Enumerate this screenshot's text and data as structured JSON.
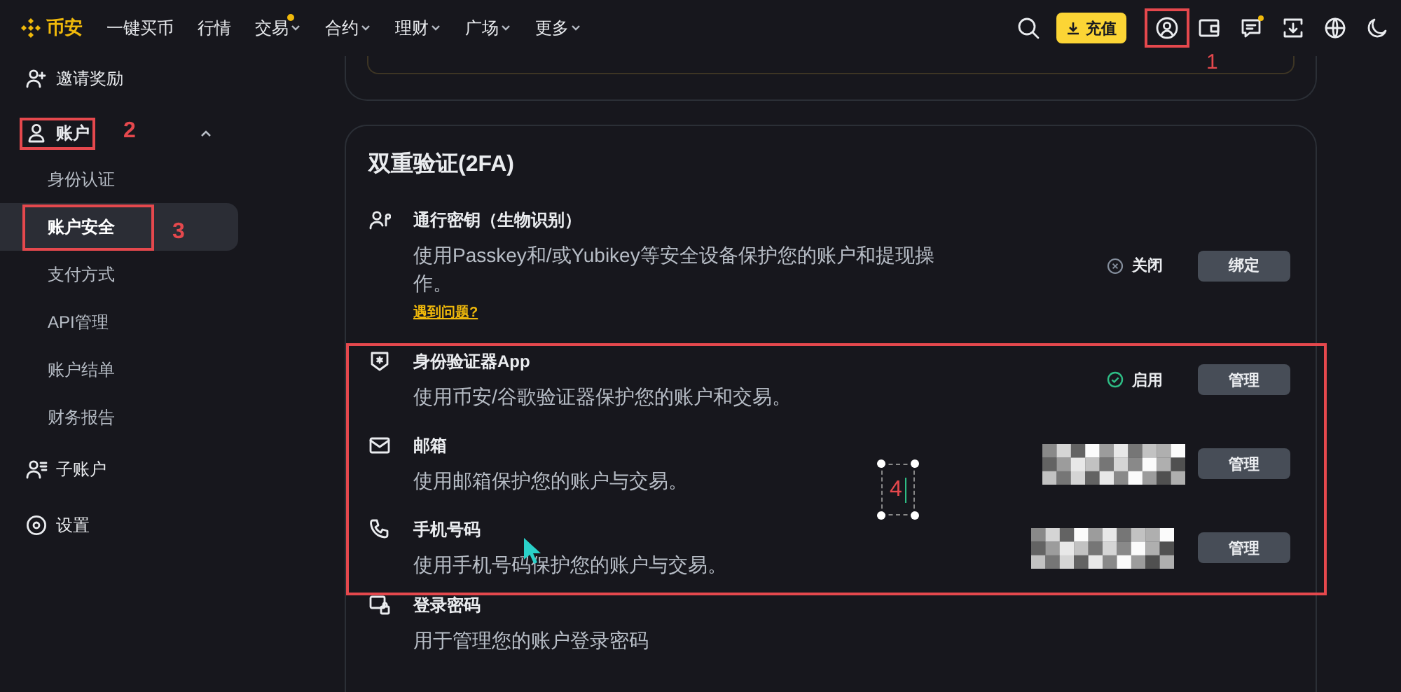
{
  "header": {
    "logo": "币安",
    "nav": [
      {
        "label": "一键买币",
        "dropdown": false,
        "dot": false
      },
      {
        "label": "行情",
        "dropdown": false,
        "dot": false
      },
      {
        "label": "交易",
        "dropdown": true,
        "dot": true
      },
      {
        "label": "合约",
        "dropdown": true,
        "dot": false
      },
      {
        "label": "理财",
        "dropdown": true,
        "dot": false
      },
      {
        "label": "广场",
        "dropdown": true,
        "dot": false
      },
      {
        "label": "更多",
        "dropdown": true,
        "dot": false
      }
    ],
    "deposit_button": "充值",
    "actions": [
      {
        "kind": "user",
        "dot": false,
        "annotation": "1"
      },
      {
        "kind": "wallet",
        "dot": false
      },
      {
        "kind": "messages",
        "dot": true
      },
      {
        "kind": "download",
        "dot": false
      },
      {
        "kind": "globe",
        "dot": false
      },
      {
        "kind": "theme",
        "dot": false
      }
    ]
  },
  "sidebar": {
    "items": [
      {
        "kind": "invite",
        "label": "邀请奖励",
        "selected": false
      },
      {
        "kind": "user",
        "label": "账户",
        "selected": false,
        "expanded": true,
        "annotation": "2",
        "children": [
          {
            "label": "身份认证",
            "selected": false
          },
          {
            "label": "账户安全",
            "selected": true,
            "annotation": "3"
          },
          {
            "label": "支付方式",
            "selected": false
          },
          {
            "label": "API管理",
            "selected": false
          },
          {
            "label": "账户结单",
            "selected": false
          },
          {
            "label": "财务报告",
            "selected": false
          }
        ]
      },
      {
        "kind": "subaccount",
        "label": "子账户",
        "selected": false
      },
      {
        "kind": "settings",
        "label": "设置",
        "selected": false
      }
    ]
  },
  "two_factor": {
    "title": "双重验证(2FA)",
    "annotation_text": "4",
    "rows": [
      {
        "kind": "status",
        "title": "通行密钥（生物识别）",
        "description": "使用Passkey和/或Yubikey等安全设备保护您的账户和提现操作。",
        "link": "遇到问题?",
        "status": {
          "label": "关闭",
          "on": false
        },
        "button": "绑定",
        "annotated": false
      },
      {
        "kind": "status",
        "title": "身份验证器App",
        "description": "使用币安/谷歌验证器保护您的账户和交易。",
        "status": {
          "label": "启用",
          "on": true
        },
        "button": "管理",
        "annotated": true
      },
      {
        "kind": "masked",
        "title": "邮箱",
        "description": "使用邮箱保护您的账户与交易。",
        "button": "管理",
        "annotated": true
      },
      {
        "kind": "masked",
        "title": "手机号码",
        "description": "使用手机号码保护您的账户与交易。",
        "button": "管理",
        "annotated": true
      },
      {
        "kind": "plain",
        "title": "登录密码",
        "description": "用于管理您的账户登录密码",
        "annotated": false
      }
    ]
  }
}
